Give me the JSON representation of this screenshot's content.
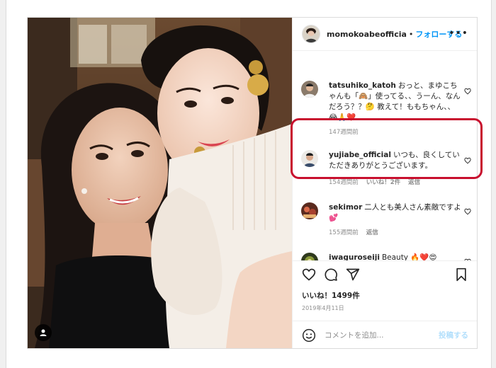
{
  "post": {
    "account": {
      "username": "momokoabeofficia",
      "separator": "•",
      "follow_label": "フォローする",
      "more_label": "•••"
    },
    "comments": [
      {
        "username": "tatsuhiko_katoh",
        "text": "おっと、まゆこちゃんも「🙈」使ってる、、うーん、なんだろう？？🤔 教えて！ももちゃん、、😂🙏❤️",
        "time": "147週間前"
      },
      {
        "username": "yujiabe_official",
        "text": "いつも、良くしていただきありがとうございます。",
        "time": "154週間前",
        "likes": "いいね！2件",
        "reply": "返信"
      },
      {
        "username": "sekimor",
        "text": "二人とも美人さん素敵ですよ💕",
        "time": "155週間前",
        "reply": "返信"
      },
      {
        "username": "iwaguroseiji",
        "text": "Beauty 🔥❤️😍"
      }
    ],
    "likes_count": "いいね！1499件",
    "date": "2019年4月11日",
    "add_comment_placeholder": "コメントを追加...",
    "post_button": "投稿する"
  },
  "icons": {
    "like": "heart-icon",
    "comment": "comment-icon",
    "share": "share-icon",
    "save": "bookmark-icon",
    "emoji": "smiley-icon",
    "tag": "user-tag-icon"
  },
  "colors": {
    "follow": "#0095f6",
    "highlight": "#c8102e",
    "post_disabled": "#b2dffc"
  }
}
